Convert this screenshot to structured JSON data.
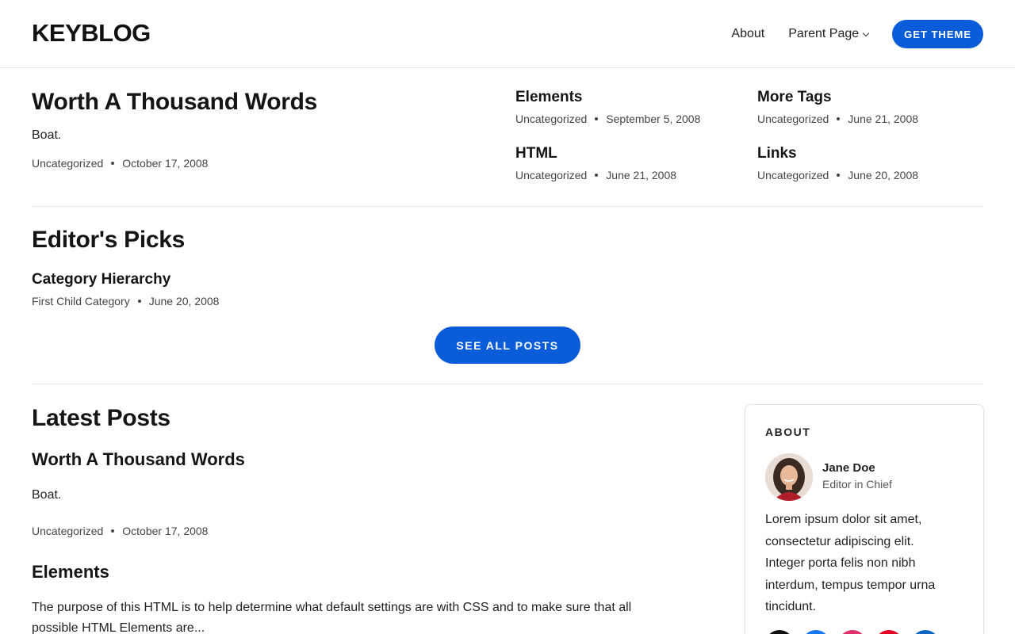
{
  "header": {
    "logo": "KEYBLOG",
    "nav": {
      "about": "About",
      "parent_page": "Parent Page"
    },
    "cta": "GET THEME"
  },
  "featured": {
    "main": {
      "title": "Worth A Thousand Words",
      "excerpt": "Boat.",
      "category": "Uncategorized",
      "date": "October 17, 2008"
    },
    "side_posts": [
      {
        "title": "Elements",
        "category": "Uncategorized",
        "date": "September 5, 2008"
      },
      {
        "title": "More Tags",
        "category": "Uncategorized",
        "date": "June 21, 2008"
      },
      {
        "title": "HTML",
        "category": "Uncategorized",
        "date": "June 21, 2008"
      },
      {
        "title": "Links",
        "category": "Uncategorized",
        "date": "June 20, 2008"
      }
    ]
  },
  "editors_picks": {
    "title": "Editor's Picks",
    "posts": [
      {
        "title": "Category Hierarchy",
        "category": "First Child Category",
        "date": "June 20, 2008"
      }
    ],
    "see_all": "SEE ALL POSTS"
  },
  "latest": {
    "title": "Latest Posts",
    "posts": [
      {
        "title": "Worth A Thousand Words",
        "excerpt": "Boat.",
        "category": "Uncategorized",
        "date": "October 17, 2008"
      },
      {
        "title": "Elements",
        "excerpt": "The purpose of this HTML is to help determine what default settings are with CSS and to make sure that all possible HTML Elements are..."
      }
    ]
  },
  "sidebar": {
    "about_label": "ABOUT",
    "author_name": "Jane Doe",
    "author_role": "Editor in Chief",
    "about_text": "Lorem ipsum dolor sit amet, consectetur adipiscing elit. Integer porta felis non nibh interdum, tempus tempor urna tincidunt."
  },
  "colors": {
    "accent": "#0b5cd8",
    "social_x": "#111111",
    "social_facebook": "#1877f2",
    "social_instagram": "#e1306c",
    "social_pinterest": "#e60023",
    "social_linkedin": "#0a66c2"
  }
}
